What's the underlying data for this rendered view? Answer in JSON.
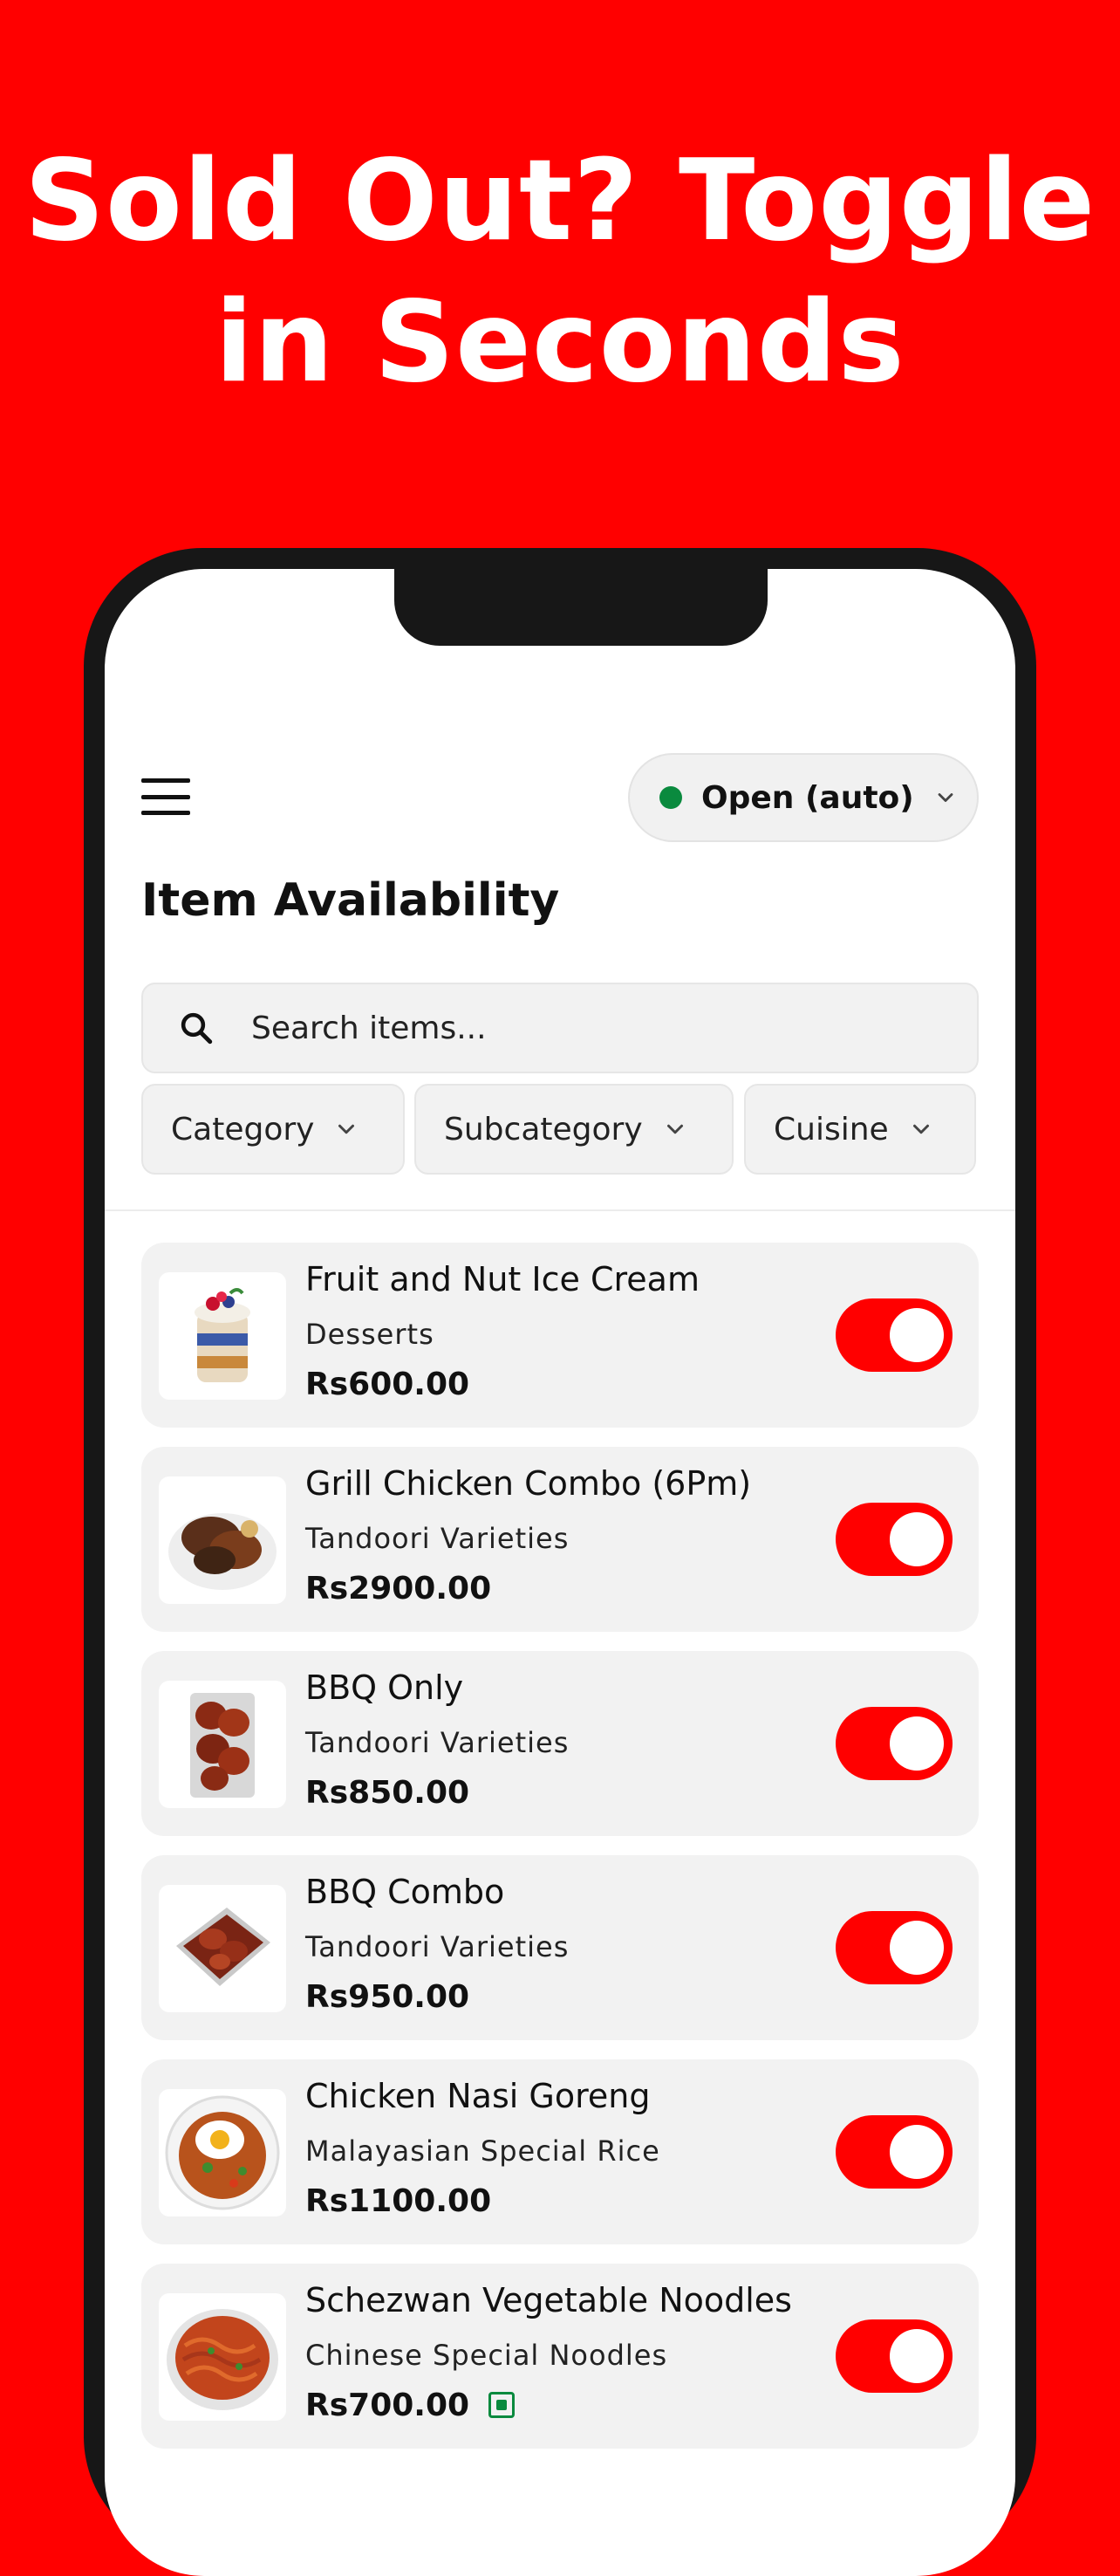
{
  "headline": {
    "line1": "Sold Out? Toggle",
    "line2": "in Seconds"
  },
  "header": {
    "status_label": "Open (auto)",
    "status_color": "#0a8a3e"
  },
  "page": {
    "title": "Item Availability"
  },
  "search": {
    "placeholder": "Search items..."
  },
  "filters": {
    "category": "Category",
    "subcategory": "Subcategory",
    "cuisine": "Cuisine"
  },
  "colors": {
    "accent": "#ff0000",
    "veg": "#0a8a3e"
  },
  "items": [
    {
      "name": "Fruit and Nut Ice Cream",
      "category": "Desserts",
      "price": "Rs600.00",
      "available": true
    },
    {
      "name": "Grill Chicken Combo (6Pm)",
      "category": "Tandoori Varieties",
      "price": "Rs2900.00",
      "available": true
    },
    {
      "name": "BBQ Only",
      "category": "Tandoori Varieties",
      "price": "Rs850.00",
      "available": true
    },
    {
      "name": "BBQ Combo",
      "category": "Tandoori Varieties",
      "price": "Rs950.00",
      "available": true
    },
    {
      "name": "Chicken Nasi Goreng",
      "category": "Malayasian Special Rice",
      "price": "Rs1100.00",
      "available": true
    },
    {
      "name": "Schezwan Vegetable Noodles",
      "category": "Chinese Special Noodles",
      "price": "Rs700.00",
      "available": true,
      "veg": true
    }
  ]
}
